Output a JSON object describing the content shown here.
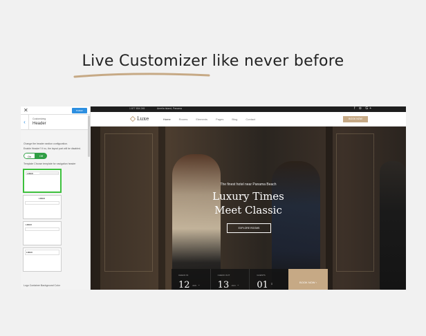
{
  "headline": "Live Customizer like never before",
  "customizer": {
    "close_icon": "close-icon",
    "publish_label": "Publish",
    "breadcrumb": "Customizing",
    "section_title": "Header",
    "description": "Change the header section configuration.",
    "enable_note": "Enable Header? If no, the layout part will be disabled.",
    "toggle_on": "On",
    "toggle_off": "Off",
    "template_label": "Template Choose template for navigation header",
    "templates": [
      {
        "logo": "LOGO"
      },
      {
        "logo": "LOGO"
      },
      {
        "logo": "LOGO"
      },
      {
        "logo": "LOGO"
      }
    ],
    "footer_label": "Logo Container Background Color",
    "accent": "#2d8fe0",
    "toggle_color": "#2f9e44",
    "selected_color": "#3cc03c"
  },
  "site": {
    "topbar": {
      "phone": "1 877 834 245",
      "address": "Amelia Island, Panama",
      "social": "f ⊚ G+"
    },
    "brand": "Luxe",
    "nav": [
      "Home",
      "Rooms",
      "Elements",
      "Pages",
      "Blog",
      "Contact"
    ],
    "nav_cta": "BOOK NOW",
    "hero": {
      "subtitle": "The finest hotel near Panama Beach",
      "title_line1": "Luxury Times",
      "title_line2": "Meet Classic",
      "button": "EXPLORE ROOMS"
    },
    "booking": {
      "fields": [
        {
          "label": "CHECK IN",
          "value": "12",
          "month": "JUN"
        },
        {
          "label": "CHECK OUT",
          "value": "13",
          "month": "JUN"
        },
        {
          "label": "GUESTS",
          "value": "01",
          "month": ""
        }
      ],
      "button": "BOOK NOW ›"
    },
    "gold": "#c6a985"
  }
}
